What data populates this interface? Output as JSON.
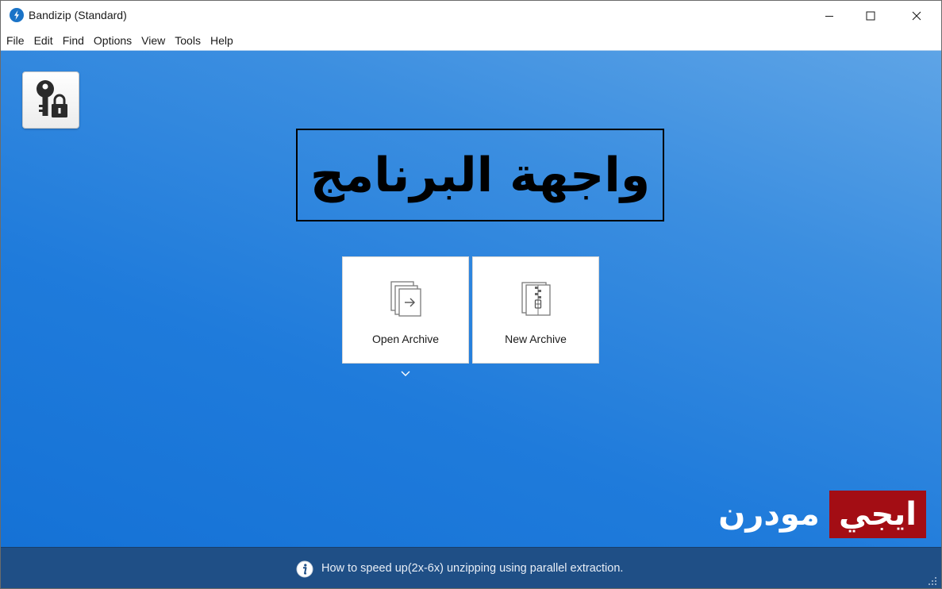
{
  "window": {
    "title": "Bandizip (Standard)"
  },
  "menu": {
    "items": [
      "File",
      "Edit",
      "Find",
      "Options",
      "View",
      "Tools",
      "Help"
    ]
  },
  "main": {
    "overlay_title": "واجهة البرنامج",
    "open_archive_label": "Open Archive",
    "new_archive_label": "New Archive"
  },
  "logo": {
    "left_text": "مودرن",
    "right_text": "ايجي"
  },
  "status": {
    "tip": "How to speed up(2x-6x) unzipping using parallel extraction."
  },
  "colors": {
    "background_gradient_start": "#5ea4e6",
    "background_gradient_end": "#1572d6",
    "statusbar": "#1f4f86",
    "logo_red": "#a30d14",
    "app_icon": "#1a73c7"
  },
  "icons": {
    "app": "bandizip-bolt-icon",
    "password": "key-lock-icon",
    "open_archive": "open-archive-icon",
    "new_archive": "new-archive-zip-icon",
    "dropdown": "chevron-down-icon",
    "info": "info-icon"
  }
}
